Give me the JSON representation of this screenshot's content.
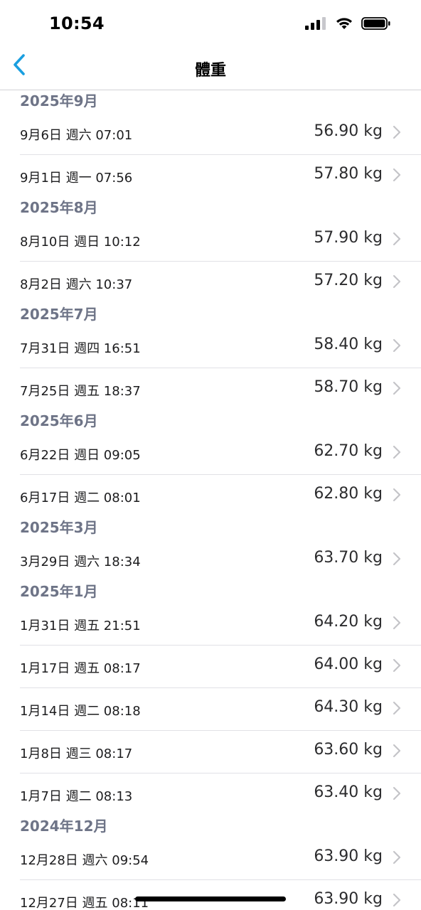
{
  "status_bar": {
    "time": "10:54",
    "icons": [
      "cellular-signal-icon",
      "wifi-icon",
      "battery-icon"
    ]
  },
  "nav": {
    "back_icon": "chevron-left-icon",
    "title": "體重",
    "accent_color": "#1a9fe0"
  },
  "sections": [
    {
      "header": "2025年9月",
      "rows": [
        {
          "date": "9月6日 週六 07:01",
          "value": "56.90 kg"
        },
        {
          "date": "9月1日 週一 07:56",
          "value": "57.80 kg"
        }
      ]
    },
    {
      "header": "2025年8月",
      "rows": [
        {
          "date": "8月10日 週日 10:12",
          "value": "57.90 kg"
        },
        {
          "date": "8月2日 週六 10:37",
          "value": "57.20 kg"
        }
      ]
    },
    {
      "header": "2025年7月",
      "rows": [
        {
          "date": "7月31日 週四 16:51",
          "value": "58.40 kg"
        },
        {
          "date": "7月25日 週五 18:37",
          "value": "58.70 kg"
        }
      ]
    },
    {
      "header": "2025年6月",
      "rows": [
        {
          "date": "6月22日 週日 09:05",
          "value": "62.70 kg"
        },
        {
          "date": "6月17日 週二 08:01",
          "value": "62.80 kg"
        }
      ]
    },
    {
      "header": "2025年3月",
      "rows": [
        {
          "date": "3月29日 週六 18:34",
          "value": "63.70 kg"
        }
      ]
    },
    {
      "header": "2025年1月",
      "rows": [
        {
          "date": "1月31日 週五 21:51",
          "value": "64.20 kg"
        },
        {
          "date": "1月17日 週五 08:17",
          "value": "64.00 kg"
        },
        {
          "date": "1月14日 週二 08:18",
          "value": "64.30 kg"
        },
        {
          "date": "1月8日 週三 08:17",
          "value": "63.60 kg"
        },
        {
          "date": "1月7日 週二 08:13",
          "value": "63.40 kg"
        }
      ]
    },
    {
      "header": "2024年12月",
      "rows": [
        {
          "date": "12月28日 週六 09:54",
          "value": "63.90 kg"
        },
        {
          "date": "12月27日 週五 08:11",
          "value": "63.90 kg"
        }
      ]
    }
  ]
}
